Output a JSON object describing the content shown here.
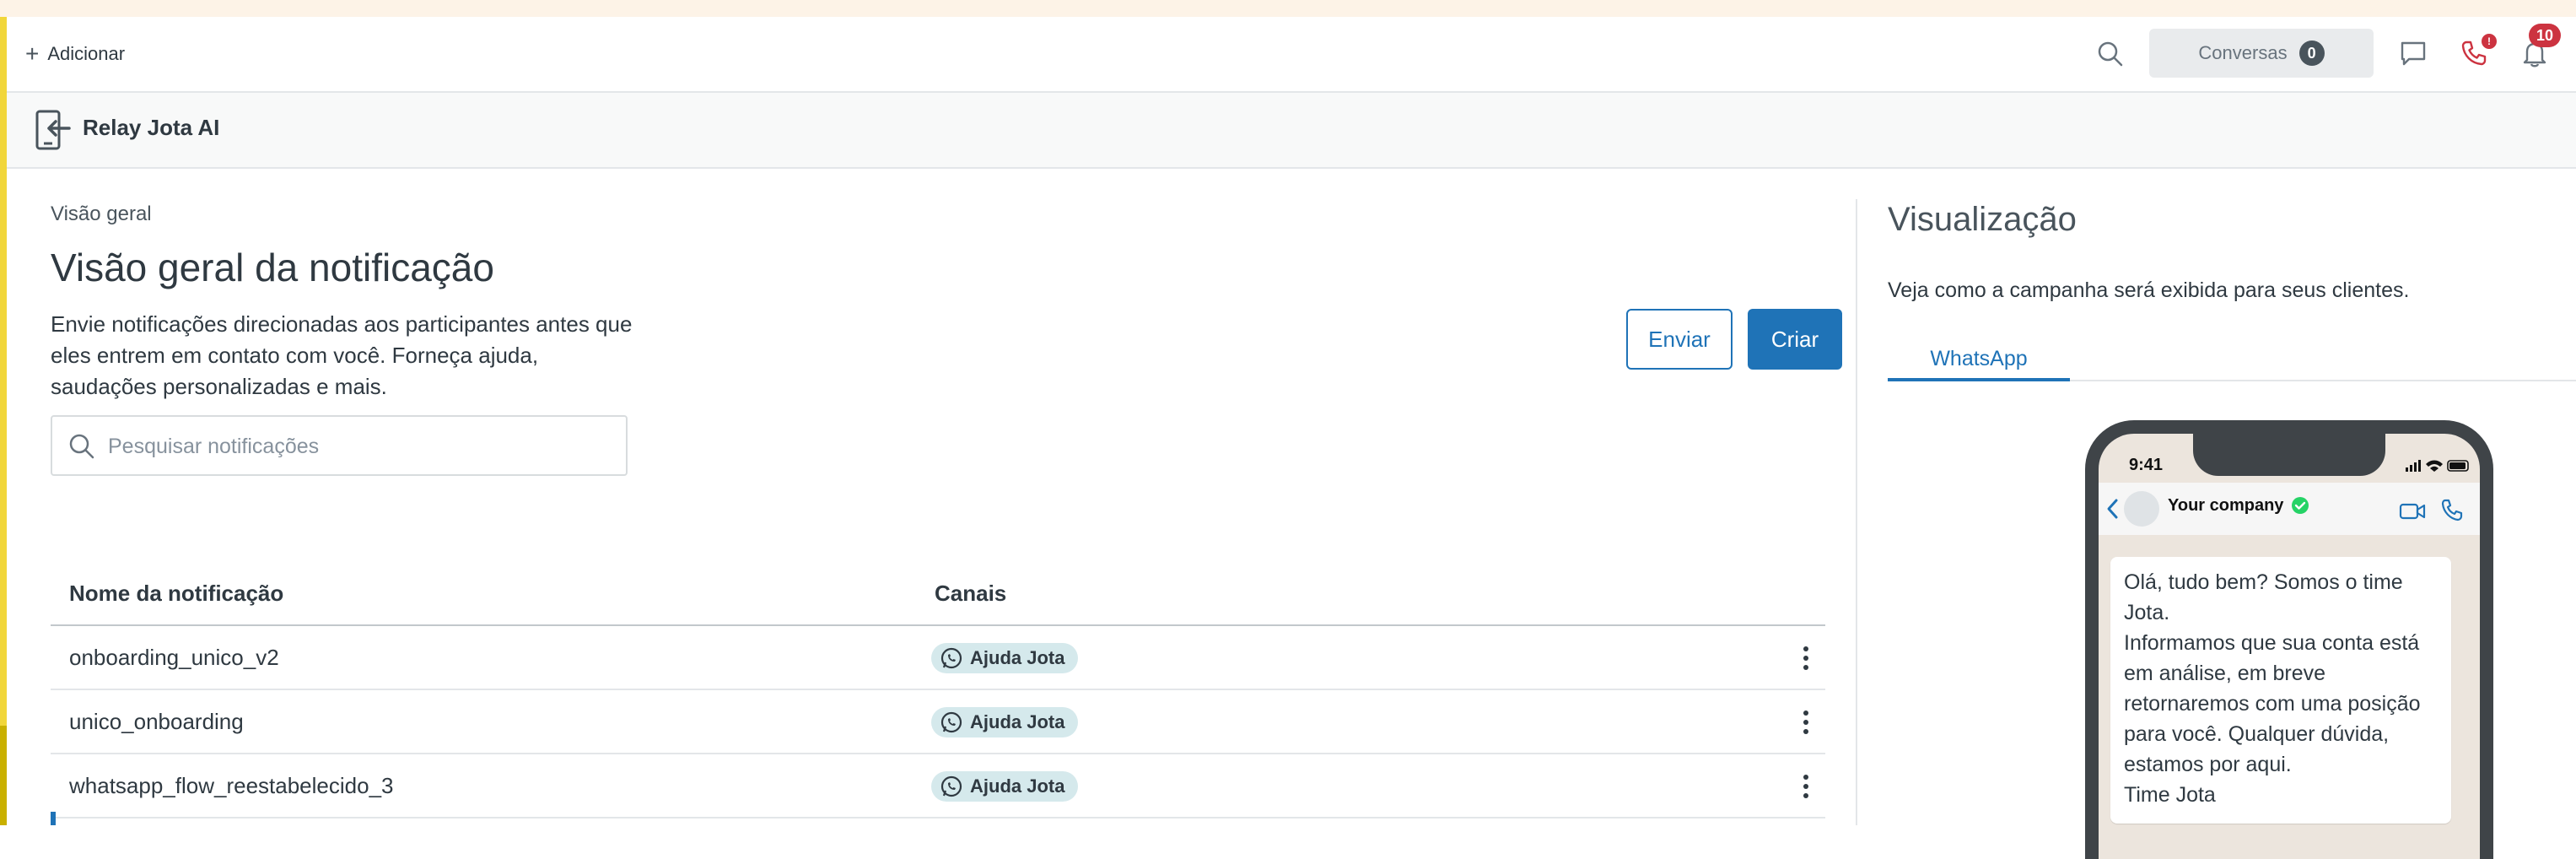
{
  "topbar": {
    "add_label": "Adicionar",
    "conversations_label": "Conversas",
    "conversations_count": "0",
    "phone_badge": "!",
    "notifications_count": "10"
  },
  "app": {
    "title": "Relay Jota AI"
  },
  "overview": {
    "breadcrumb": "Visão geral",
    "title": "Visão geral da notificação",
    "description": "Envie notificações direcionadas aos participantes antes que eles entrem em contato com você. Forneça ajuda, saudações personalizadas e mais.",
    "send_label": "Enviar",
    "create_label": "Criar",
    "search_placeholder": "Pesquisar notificações"
  },
  "table": {
    "columns": [
      "Nome da notificação",
      "Canais"
    ],
    "rows": [
      {
        "name": "onboarding_unico_v2",
        "channel": "Ajuda Jota"
      },
      {
        "name": "unico_onboarding",
        "channel": "Ajuda Jota"
      },
      {
        "name": "whatsapp_flow_reestabelecido_3",
        "channel": "Ajuda Jota"
      }
    ]
  },
  "preview": {
    "title": "Visualização",
    "description": "Veja como a campanha será exibida para seus clientes.",
    "tab_label": "WhatsApp",
    "phone_time": "9:41",
    "contact_name": "Your company",
    "message": "Olá, tudo bem? Somos o time Jota.\nInformamos que sua conta está em análise, em breve retornaremos com uma posição para você. Qualquer dúvida, estamos por aqui.\nTime Jota"
  },
  "colors": {
    "primary": "#1f73b7",
    "badge_red": "#cc3340",
    "accent_yellow": "#f1d63a",
    "chip_bg": "#d5e9ec",
    "whatsapp_green": "#25d366"
  },
  "icons": [
    "plus-icon",
    "search-icon",
    "chat-icon",
    "phone-icon",
    "bell-icon",
    "app-icon",
    "whatsapp-icon",
    "kebab-icon",
    "back-icon",
    "video-icon",
    "call-icon",
    "verified-icon"
  ]
}
